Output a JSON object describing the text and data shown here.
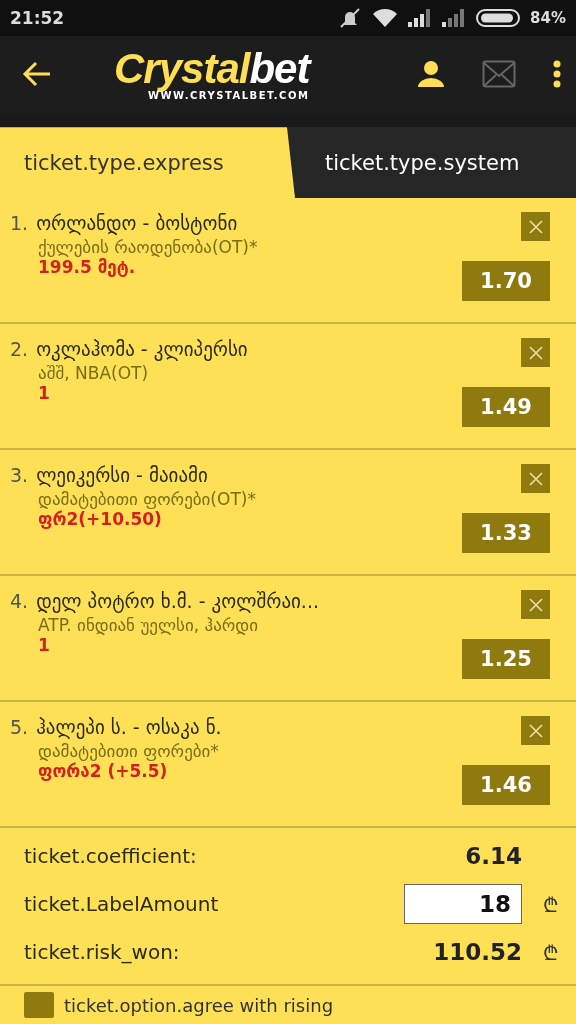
{
  "status_bar": {
    "time": "21:52",
    "battery": "84%"
  },
  "header": {
    "logo": {
      "part_1": "Crystal",
      "part_2": "bet",
      "url": "WWW.CRYSTALBET.COM"
    }
  },
  "tabs": [
    {
      "label": "ticket.type.express",
      "selected": true
    },
    {
      "label": "ticket.type.system",
      "selected": false
    }
  ],
  "bets": [
    {
      "index": "1.",
      "match": "ორლანდო - ბოსტონი",
      "market": "ქულების რაოდენობა(OT)*",
      "pick": "199.5 მეტ.",
      "odds": "1.70"
    },
    {
      "index": "2.",
      "match": "ოკლაჰომა - კლიპერსი",
      "market": "აშშ, NBA(OT)",
      "pick": "1",
      "odds": "1.49"
    },
    {
      "index": "3.",
      "match": "ლეიკერსი - მაიამი",
      "market": "დამატებითი ფორები(OT)*",
      "pick": "ფრ2(+10.50)",
      "odds": "1.33"
    },
    {
      "index": "4.",
      "match": "დელ პოტრო ხ.მ. - კოლშრაი...",
      "market": "ATP. ინდიან უელსი, ჰარდი",
      "pick": "1",
      "odds": "1.25"
    },
    {
      "index": "5.",
      "match": "ჰალეპი ს. - ოსაკა ნ.",
      "market": "დამატებითი ფორები*",
      "pick": "ფორა2 (+5.5)",
      "odds": "1.46"
    }
  ],
  "summary": {
    "coefficient_label": "ticket.coefficient:",
    "coefficient": "6.14",
    "amount_label": "ticket.LabelAmount",
    "amount": "18",
    "amount_currency": "₾",
    "won_label": "ticket.risk_won:",
    "won": "110.52",
    "won_currency": "₾"
  },
  "option": {
    "label": "ticket.option.agree with rising",
    "checked": false
  }
}
